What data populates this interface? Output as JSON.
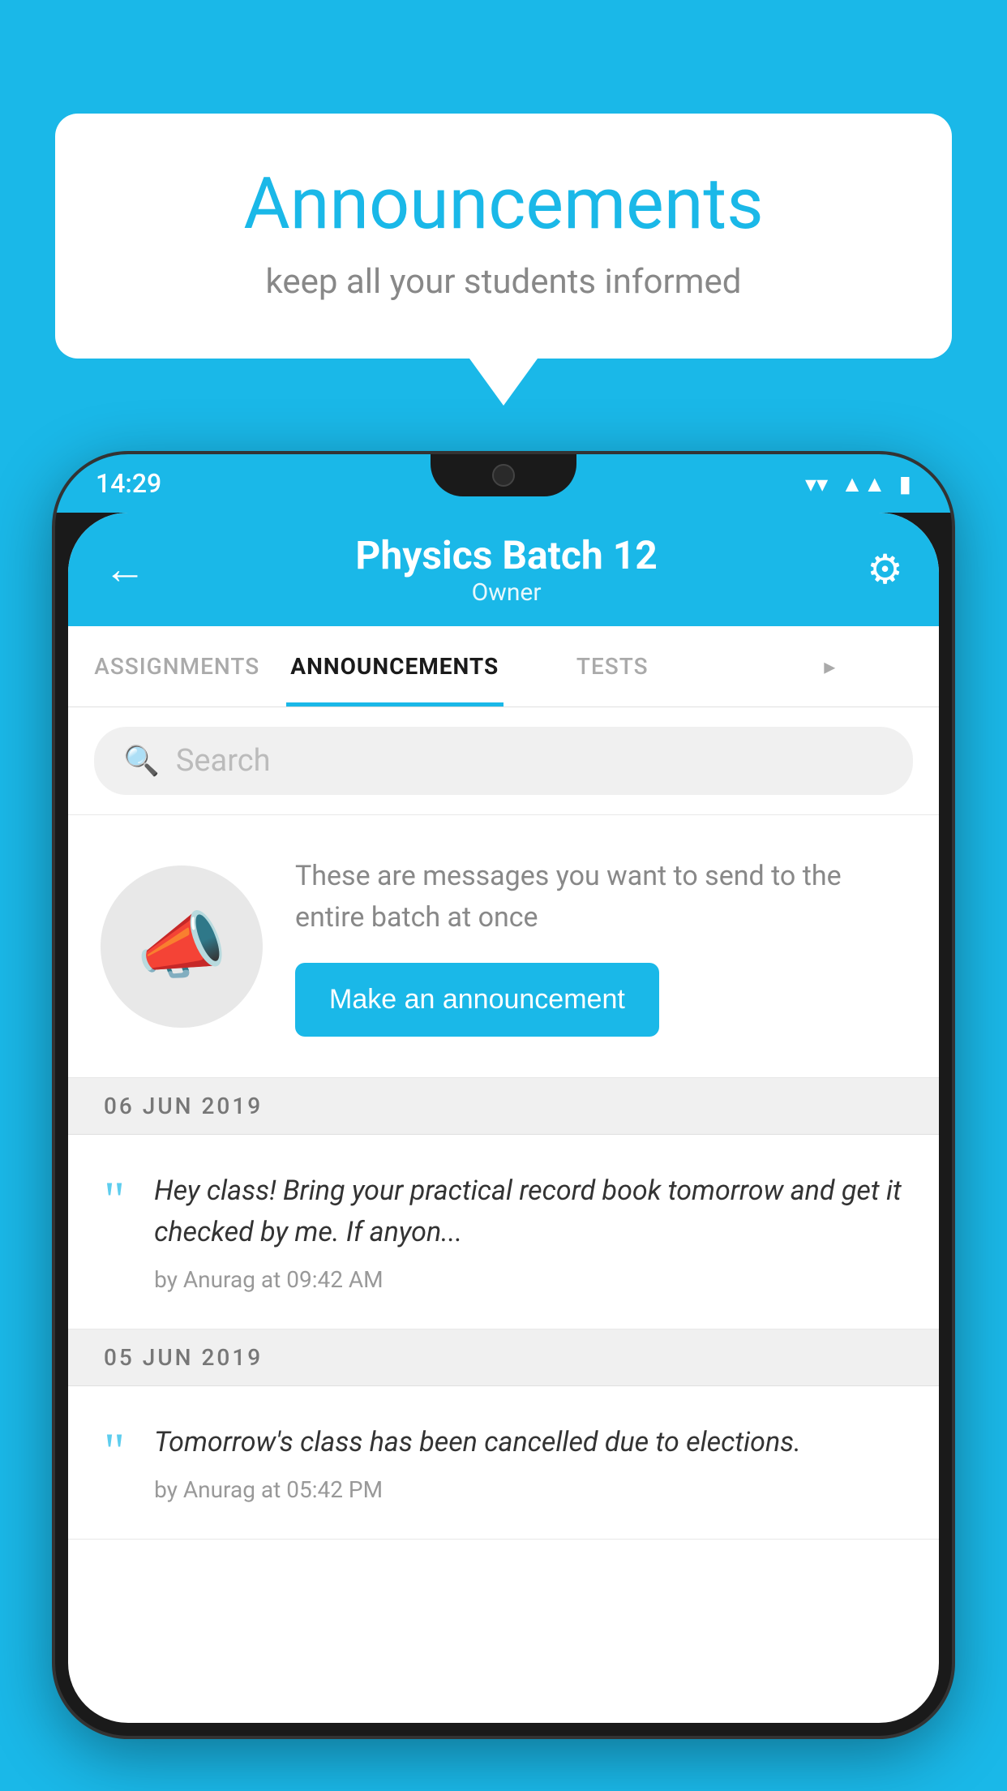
{
  "page": {
    "background_color": "#1ab8e8"
  },
  "speech_bubble": {
    "title": "Announcements",
    "subtitle": "keep all your students informed"
  },
  "phone": {
    "status_bar": {
      "time": "14:29",
      "icons": [
        "wifi",
        "signal",
        "battery"
      ]
    },
    "app_header": {
      "back_label": "←",
      "title": "Physics Batch 12",
      "subtitle": "Owner",
      "gear_label": "⚙"
    },
    "tabs": [
      {
        "label": "ASSIGNMENTS",
        "active": false
      },
      {
        "label": "ANNOUNCEMENTS",
        "active": true
      },
      {
        "label": "TESTS",
        "active": false
      },
      {
        "label": "...",
        "active": false
      }
    ],
    "search": {
      "placeholder": "Search",
      "icon": "🔍"
    },
    "promo": {
      "description": "These are messages you want to send to the entire batch at once",
      "button_label": "Make an announcement"
    },
    "announcements": [
      {
        "date": "06  JUN  2019",
        "message": "Hey class! Bring your practical record book tomorrow and get it checked by me. If anyon...",
        "meta": "by Anurag at 09:42 AM"
      },
      {
        "date": "05  JUN  2019",
        "message": "Tomorrow's class has been cancelled due to elections.",
        "meta": "by Anurag at 05:42 PM"
      }
    ]
  }
}
